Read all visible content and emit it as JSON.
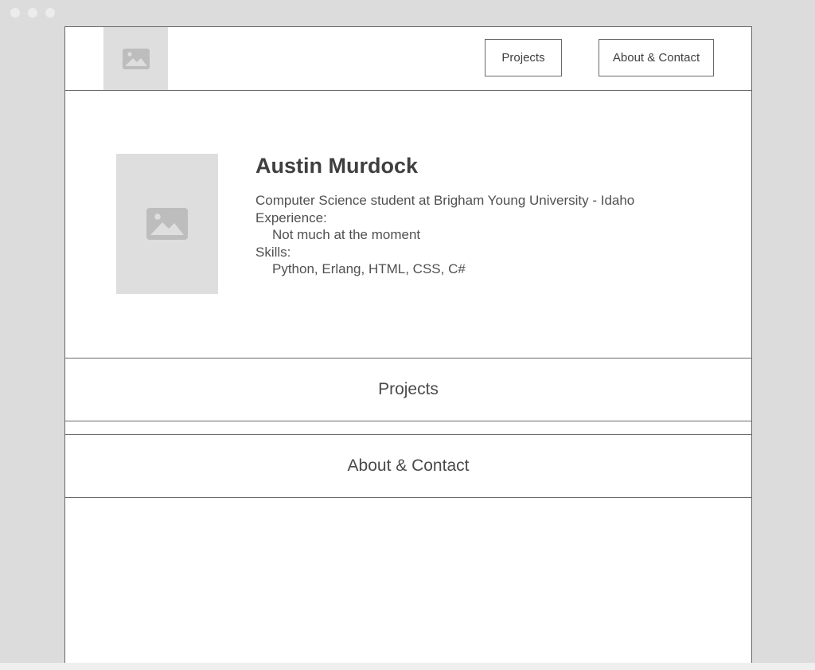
{
  "nav": {
    "projects_label": "Projects",
    "about_label": "About & Contact"
  },
  "icons": {
    "logo": "image-placeholder-icon",
    "portrait": "image-placeholder-icon"
  },
  "colors": {
    "placeholder_bg": "#dedede",
    "placeholder_icon": "#bdbdbd",
    "text": "#3f3f3f",
    "border": "#6a6a6a"
  },
  "profile": {
    "name": "Austin Murdock",
    "tagline": "Computer Science student at Brigham Young University - Idaho",
    "experience_label": "Experience:",
    "experience_value": "Not much at the moment",
    "skills_label": "Skills:",
    "skills_value": "Python, Erlang, HTML, CSS, C#"
  },
  "sections": {
    "projects_title": "Projects",
    "about_title": "About & Contact"
  }
}
